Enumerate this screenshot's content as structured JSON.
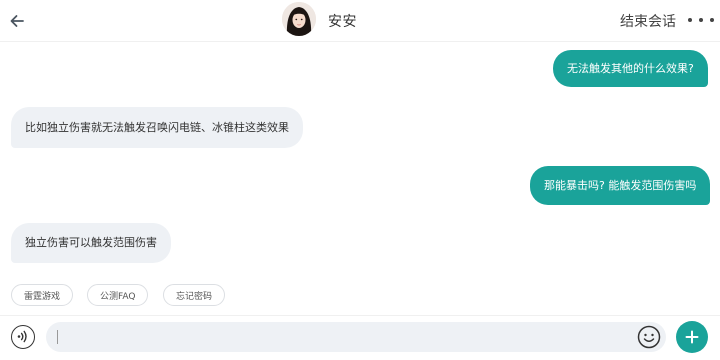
{
  "header": {
    "title": "安安",
    "end_label": "结束会话",
    "back_icon": "arrow-left-icon",
    "more_icon": "more-dots-icon"
  },
  "messages": [
    {
      "side": "out",
      "text": "无法触发其他的什么效果?"
    },
    {
      "side": "in",
      "text": "比如独立伤害就无法触发召唤闪电链、冰锥柱这类效果"
    },
    {
      "side": "out",
      "text": "那能暴击吗? 能触发范围伤害吗"
    },
    {
      "side": "in",
      "text": "独立伤害可以触发范围伤害"
    }
  ],
  "quick_replies": [
    {
      "label": "雷霆游戏"
    },
    {
      "label": "公测FAQ"
    },
    {
      "label": "忘记密码"
    }
  ],
  "input": {
    "value": "",
    "voice_icon": "voice-icon",
    "emoji_icon": "emoji-icon",
    "plus_icon": "plus-icon"
  },
  "colors": {
    "accent": "#1aa39a",
    "incoming_bubble": "#eef1f5",
    "outgoing_text": "#ffffff"
  }
}
